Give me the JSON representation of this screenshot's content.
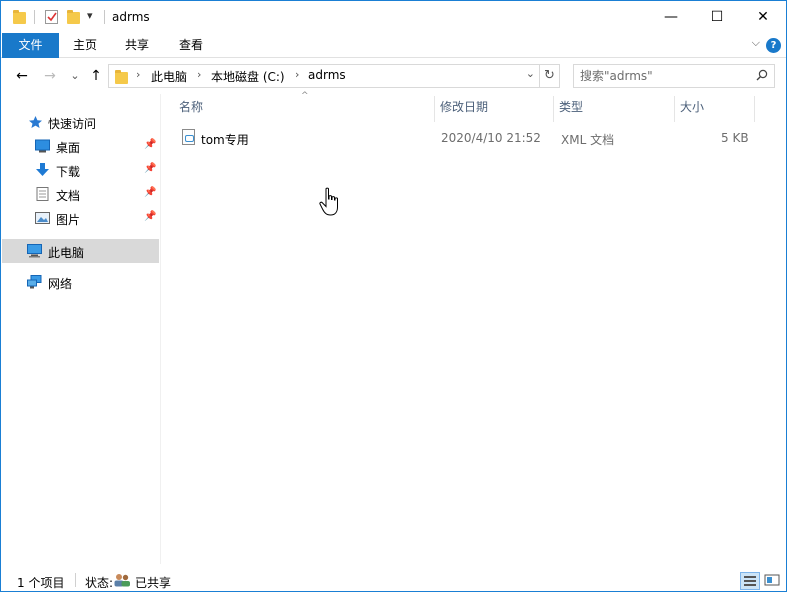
{
  "titlebar": {
    "title": "adrms",
    "minimize": "—",
    "maximize": "☐",
    "close": "✕",
    "qa_dropdown": "▾"
  },
  "ribbon": {
    "tabs": [
      {
        "label": "文件"
      },
      {
        "label": "主页"
      },
      {
        "label": "共享"
      },
      {
        "label": "查看"
      }
    ],
    "collapse": "⌵",
    "help": "?"
  },
  "nav": {
    "back": "←",
    "forward": "→",
    "recent": "⌄",
    "up": "↑",
    "breadcrumb": [
      {
        "label": "此电脑"
      },
      {
        "label": "本地磁盘 (C:)"
      },
      {
        "label": "adrms"
      }
    ],
    "crumb_sep": "›",
    "dropdown": "⌄",
    "refresh": "↻"
  },
  "search": {
    "placeholder": "搜索\"adrms\""
  },
  "navpane": {
    "quick_access": "快速访问",
    "items": [
      {
        "label": "桌面",
        "icon": "desktop-icon"
      },
      {
        "label": "下载",
        "icon": "download-icon"
      },
      {
        "label": "文档",
        "icon": "documents-icon"
      },
      {
        "label": "图片",
        "icon": "pictures-icon"
      }
    ],
    "this_pc": "此电脑",
    "network": "网络",
    "pin": "📌"
  },
  "columns": {
    "name": "名称",
    "date": "修改日期",
    "type": "类型",
    "size": "大小",
    "sort": "^"
  },
  "files": [
    {
      "name": "tom专用",
      "date": "2020/4/10 21:52",
      "type": "XML 文档",
      "size": "5 KB"
    }
  ],
  "status": {
    "count": "1 个项目",
    "state_label": "状态:",
    "state_value": "已共享"
  },
  "colors": {
    "accent": "#1979ca",
    "selected": "#d9d9d9",
    "header_text": "#4c607a",
    "meta_text": "#6d6d6d"
  }
}
